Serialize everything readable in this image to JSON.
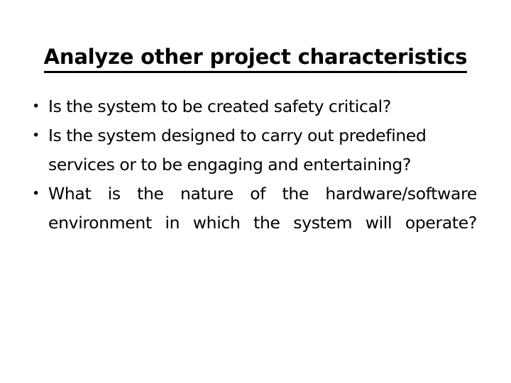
{
  "slide": {
    "title": "Analyze other project characteristics",
    "background_color": "#ffffff",
    "text_color": "#000000",
    "bullet_glyph": "•",
    "bullets": [
      {
        "text": "Is the system to be created safety critical?",
        "align": "left"
      },
      {
        "text": "Is the system designed to carry out predefined services or to be engaging and entertaining?",
        "align": "left"
      },
      {
        "text": "What is the nature of the hardware/software environment in which the system will operate?",
        "align": "justify"
      }
    ]
  }
}
